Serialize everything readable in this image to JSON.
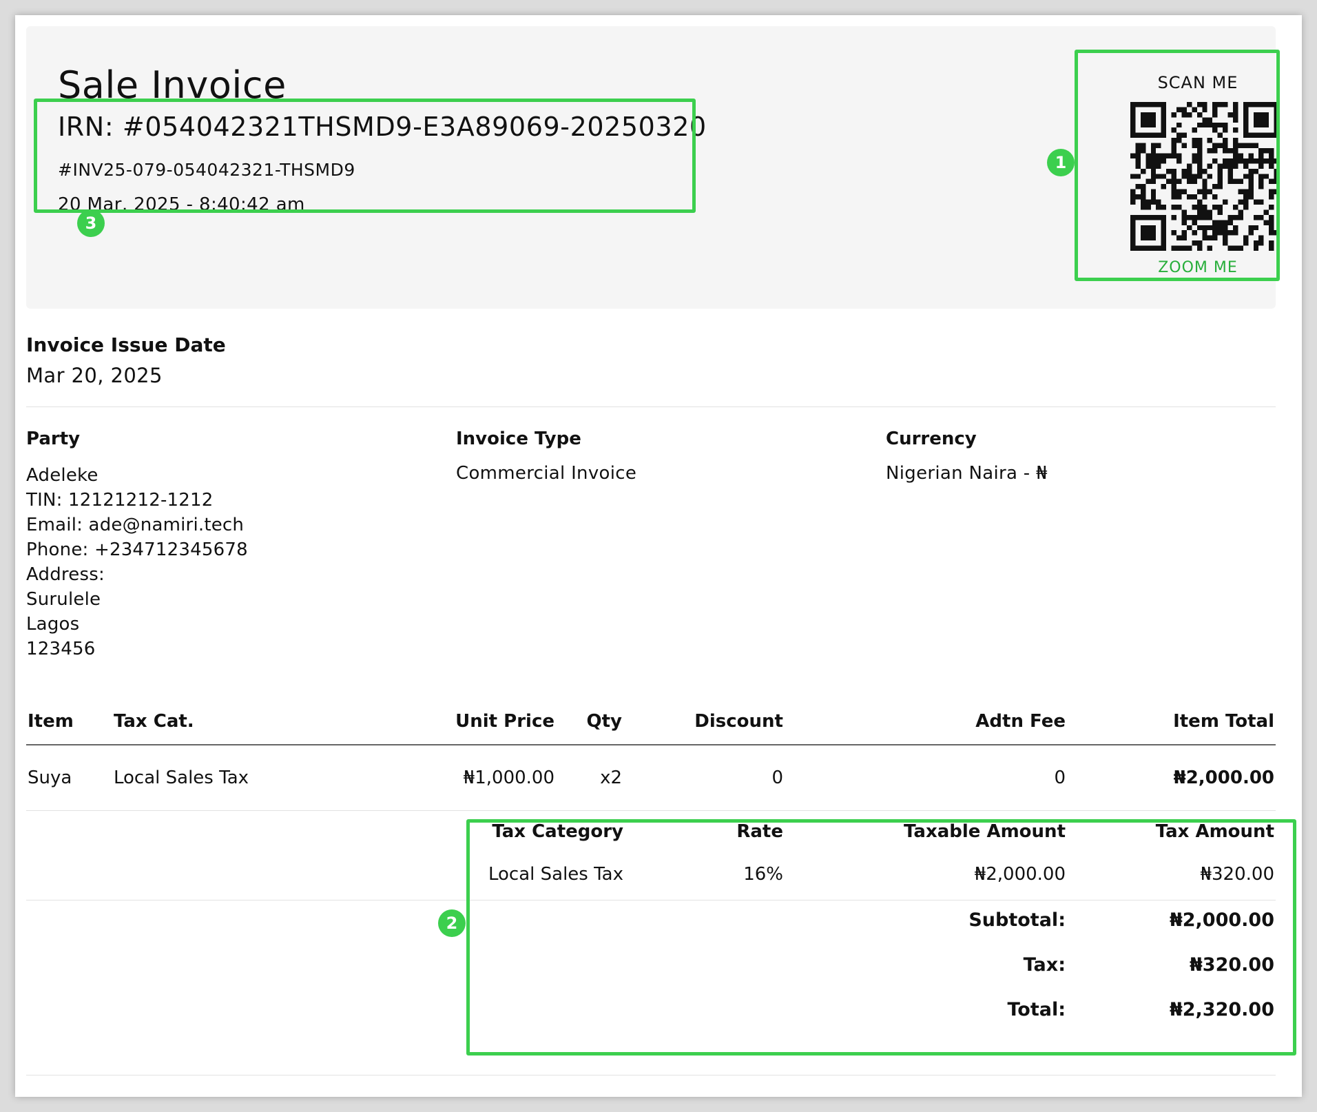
{
  "header": {
    "title": "Sale Invoice",
    "irn": "IRN: #054042321THSMD9-E3A89069-20250320",
    "invoice_number": "#INV25-079-054042321-THSMD9",
    "datetime": "20 Mar, 2025 - 8:40:42 am"
  },
  "qr": {
    "scan_label": "SCAN ME",
    "zoom_label": "ZOOM ME",
    "icon": "qr-code-icon"
  },
  "annotations": [
    "1",
    "2",
    "3"
  ],
  "issue": {
    "label": "Invoice Issue Date",
    "value": "Mar 20, 2025"
  },
  "party": {
    "label": "Party",
    "name": "Adeleke",
    "tin": "TIN: 12121212-1212",
    "email": "Email: ade@namiri.tech",
    "phone": "Phone: +234712345678",
    "address_label": "Address:",
    "address_line1": "Surulele",
    "address_line2": "Lagos",
    "address_line3": "123456"
  },
  "invoice_type": {
    "label": "Invoice Type",
    "value": "Commercial Invoice"
  },
  "currency": {
    "label": "Currency",
    "value": "Nigerian Naira - ₦"
  },
  "items_table": {
    "headers": {
      "item": "Item",
      "tax_cat": "Tax Cat.",
      "unit_price": "Unit Price",
      "qty": "Qty",
      "discount": "Discount",
      "adtn_fee": "Adtn Fee",
      "item_total": "Item Total"
    },
    "rows": [
      {
        "item": "Suya",
        "tax_cat": "Local Sales Tax",
        "unit_price": "₦1,000.00",
        "qty": "x2",
        "discount": "0",
        "adtn_fee": "0",
        "item_total": "₦2,000.00"
      }
    ]
  },
  "tax_table": {
    "headers": {
      "category": "Tax Category",
      "rate": "Rate",
      "taxable": "Taxable Amount",
      "amount": "Tax Amount"
    },
    "rows": [
      {
        "category": "Local Sales Tax",
        "rate": "16%",
        "taxable": "₦2,000.00",
        "amount": "₦320.00"
      }
    ]
  },
  "summary": {
    "subtotal_label": "Subtotal:",
    "subtotal": "₦2,000.00",
    "tax_label": "Tax:",
    "tax": "₦320.00",
    "total_label": "Total:",
    "total": "₦2,320.00"
  },
  "colors": {
    "annotation": "#3ccf4e",
    "zoom_link": "#27ae3a",
    "header_bg": "#f5f5f5"
  }
}
